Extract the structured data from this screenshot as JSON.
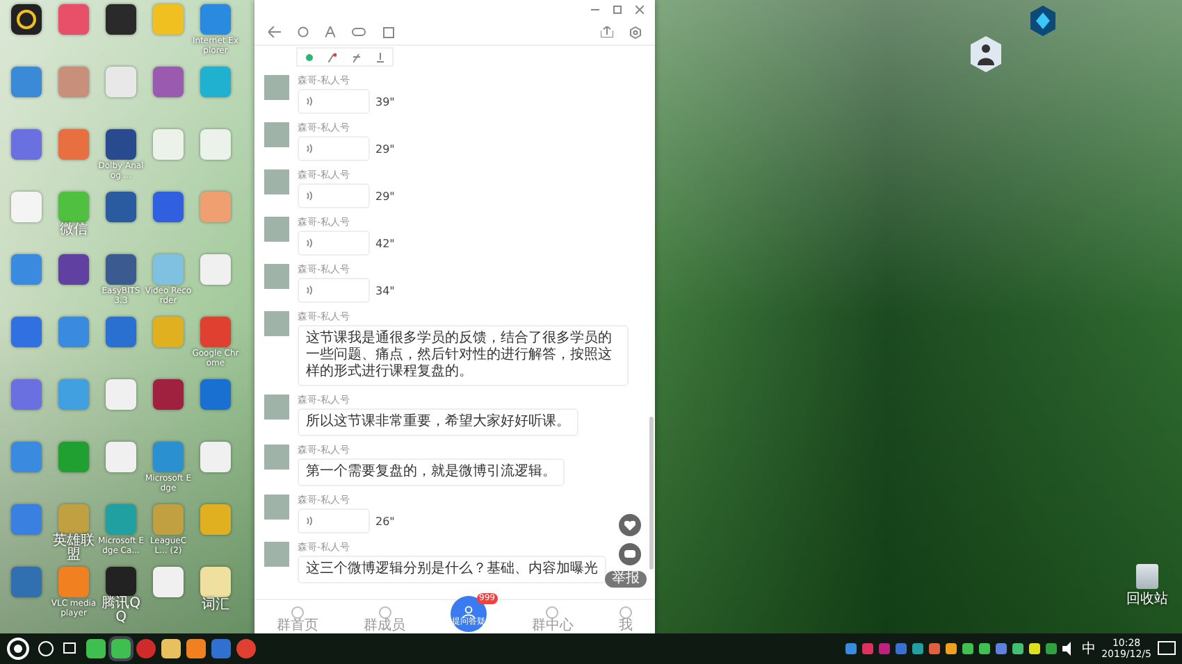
{
  "desktop_icons": [
    {
      "color": "#222222",
      "kind": "camera"
    },
    {
      "color": "#e8506a"
    },
    {
      "color": "#2a2a2a"
    },
    {
      "color": "#f0c020"
    },
    {
      "color": "#2a8ae0",
      "label": "Internet Explorer"
    },
    {
      "color": "#3a8ad8"
    },
    {
      "color": "#c8907a"
    },
    {
      "color": "#e8e8e8"
    },
    {
      "color": "#9a5ab0"
    },
    {
      "color": "#20b0d0"
    },
    {
      "color": "#6a70e0"
    },
    {
      "color": "#e87040"
    },
    {
      "color": "#2a4a90",
      "label": "Dolby Analog ..."
    },
    {
      "color": "#eaf2ea"
    },
    {
      "color": "#eaf2ea"
    },
    {
      "color": "#f4f4f4"
    },
    {
      "color": "#50c040",
      "label": "微信"
    },
    {
      "color": "#2a5aa0"
    },
    {
      "color": "#3060e0"
    },
    {
      "color": "#f0a070"
    },
    {
      "color": "#3a8ae0"
    },
    {
      "color": "#6040a0"
    },
    {
      "color": "#3a5a90",
      "label": "EasyBITS 3.3"
    },
    {
      "color": "#80c0e0",
      "label": "Video Recorder"
    },
    {
      "color": "#f0f0f0"
    },
    {
      "color": "#3070e0"
    },
    {
      "color": "#3a8ae0"
    },
    {
      "color": "#2a70d0"
    },
    {
      "color": "#e0b020"
    },
    {
      "color": "#e04030",
      "label": "Google Chrome"
    },
    {
      "color": "#6a70e0"
    },
    {
      "color": "#40a0e0"
    },
    {
      "color": "#f0f0f0"
    },
    {
      "color": "#a02040"
    },
    {
      "color": "#1a70d0"
    },
    {
      "color": "#3a8ae0"
    },
    {
      "color": "#20a030"
    },
    {
      "color": "#f0f0f0"
    },
    {
      "color": "#2a90d0",
      "label": "Microsoft Edge"
    },
    {
      "color": "#f0f0f0"
    },
    {
      "color": "#3a80e0"
    },
    {
      "color": "#c0a040",
      "label": "英雄联盟"
    },
    {
      "color": "#20a0a0",
      "label": "Microsoft Edge Ca..."
    },
    {
      "color": "#c0a040",
      "label": "LeagueCL... (2)"
    },
    {
      "color": "#e0b020"
    },
    {
      "color": "#3070b0"
    },
    {
      "color": "#f08020",
      "label": "VLC media player"
    },
    {
      "color": "#222222",
      "label": "腾讯QQ"
    },
    {
      "color": "#f0f0f0"
    },
    {
      "color": "#f0e0a0",
      "label": "词汇"
    }
  ],
  "chat_window": {
    "messages": [
      {
        "sender": "森哥-私人号",
        "kind": "voice",
        "duration": "39\""
      },
      {
        "sender": "森哥-私人号",
        "kind": "voice",
        "duration": "29\""
      },
      {
        "sender": "森哥-私人号",
        "kind": "voice",
        "duration": "29\""
      },
      {
        "sender": "森哥-私人号",
        "kind": "voice",
        "duration": "42\""
      },
      {
        "sender": "森哥-私人号",
        "kind": "voice",
        "duration": "34\""
      },
      {
        "sender": "森哥-私人号",
        "kind": "text",
        "text": "这节课我是通很多学员的反馈，结合了很多学员的一些问题、痛点，然后针对性的进行解答，按照这样的形式进行课程复盘的。"
      },
      {
        "sender": "森哥-私人号",
        "kind": "text",
        "text": "所以这节课非常重要，希望大家好好听课。"
      },
      {
        "sender": "森哥-私人号",
        "kind": "text",
        "text": "第一个需要复盘的，就是微博引流逻辑。"
      },
      {
        "sender": "森哥-私人号",
        "kind": "voice",
        "duration": "26\""
      },
      {
        "sender": "森哥-私人号",
        "kind": "text",
        "text": "这三个微博逻辑分别是什么？基础、内容加曝光"
      }
    ],
    "report_label": "举报",
    "nav": [
      {
        "label": "群首页",
        "kind": "tab"
      },
      {
        "label": "群成员",
        "kind": "tab"
      },
      {
        "label": "提问答疑",
        "kind": "center",
        "badge": "999"
      },
      {
        "label": "群中心",
        "kind": "tab"
      },
      {
        "label": "我",
        "kind": "tab"
      }
    ]
  },
  "recycle_bin": {
    "label": "回收站"
  },
  "taskbar": {
    "ime": "中",
    "time": "10:28",
    "date": "2019/12/5"
  }
}
